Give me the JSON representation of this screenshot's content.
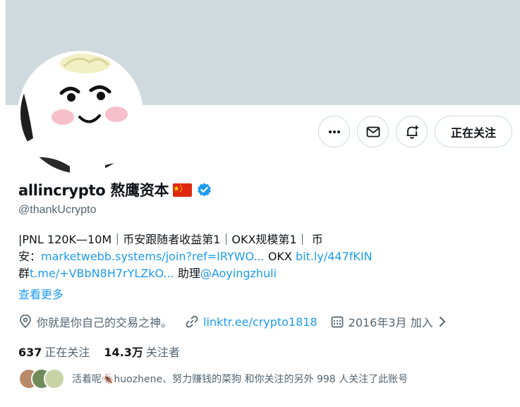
{
  "profile": {
    "display_name": "allincrypto 熬鹰资本",
    "handle": "@thankUcrypto",
    "bio": {
      "line1": "|PNL 120K—10M｜币安跟随者收益第1｜OKX规模第1｜ 币",
      "line2_prefix": "安：",
      "line2_link1": "marketwebb.systems/join?ref=IRYWO...",
      "line2_mid": " OKX ",
      "line2_link2": "bit.ly/447fKIN",
      "line3_prefix": "群",
      "line3_link": "t.me/+VBbN8H7rYLZkO...",
      "line3_mid": " 助理",
      "line3_mention": "@Aoyingzhuli"
    },
    "see_more": "查看更多",
    "location": "你就是你自己的交易之神。",
    "website": "linktr.ee/crypto1818",
    "joined": "2016年3月 加入"
  },
  "actions": {
    "follow_label": "正在关注",
    "more_icon": "more-icon",
    "message_icon": "mail-icon",
    "notify_icon": "bell-plus-icon"
  },
  "stats": {
    "following_count": "637",
    "following_label": "正在关注",
    "followers_count": "14.3万",
    "followers_label": "关注者"
  },
  "followers_you_know": "活着呢🪳huozhene、努力赚钱的菜狗 和你关注的另外 998 人关注了此账号",
  "colors": {
    "banner": "#cfd9de",
    "link": "#1d9bf0",
    "secondary_text": "#536471",
    "verified": "#1d9bf0",
    "flag_red": "#de2910",
    "flag_star": "#ffde00"
  }
}
